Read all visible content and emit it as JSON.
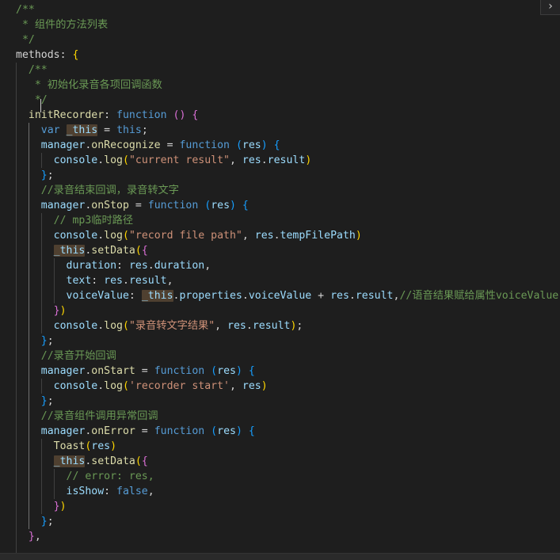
{
  "colors": {
    "background": "#1e1e1e",
    "comment": "#6a9955",
    "keyword": "#569cd6",
    "control": "#c586c0",
    "function": "#dcdcaa",
    "property": "#9cdcfe",
    "string": "#ce9178",
    "plain": "#d4d4d4",
    "bracket_gold": "#ffd700",
    "bracket_pink": "#da70d6",
    "bracket_blue": "#179fff"
  },
  "sidebar_toggle": {
    "icon": "chevron-right-icon",
    "glyph": "›"
  },
  "code_lines": [
    {
      "indent": 0,
      "tokens": [
        [
          "/**",
          "#6a9955"
        ]
      ]
    },
    {
      "indent": 0,
      "tokens": [
        [
          " * 组件的方法列表",
          "#6a9955"
        ]
      ]
    },
    {
      "indent": 0,
      "tokens": [
        [
          " */",
          "#6a9955"
        ]
      ]
    },
    {
      "indent": 0,
      "tokens": [
        [
          "methods",
          "#d4d4d4"
        ],
        [
          ": ",
          "#d4d4d4"
        ],
        [
          "{",
          "#ffd700"
        ]
      ]
    },
    {
      "indent": 1,
      "tokens": [
        [
          "/**",
          "#6a9955"
        ]
      ]
    },
    {
      "indent": 1,
      "tokens": [
        [
          " * 初始化录音各项回调函数",
          "#6a9955"
        ]
      ]
    },
    {
      "indent": 1,
      "tokens": [
        [
          " */",
          "#6a9955"
        ]
      ]
    },
    {
      "indent": 1,
      "tokens": [
        [
          "initRecorder",
          "#dcdcaa"
        ],
        [
          ": ",
          "#d4d4d4"
        ],
        [
          "function",
          "#569cd6"
        ],
        [
          " ",
          "#d4d4d4"
        ],
        [
          "()",
          "#da70d6"
        ],
        [
          " ",
          "#d4d4d4"
        ],
        [
          "{",
          "#da70d6"
        ]
      ]
    },
    {
      "indent": 2,
      "tokens": [
        [
          "var",
          "#569cd6"
        ],
        [
          " ",
          "#d4d4d4"
        ],
        [
          "_this",
          "#9cdcfe",
          "hl"
        ],
        [
          " = ",
          "#d4d4d4"
        ],
        [
          "this",
          "#569cd6"
        ],
        [
          ";",
          "#d4d4d4"
        ]
      ]
    },
    {
      "indent": 2,
      "tokens": [
        [
          "manager",
          "#9cdcfe"
        ],
        [
          ".",
          "#d4d4d4"
        ],
        [
          "onRecognize",
          "#dcdcaa"
        ],
        [
          " = ",
          "#d4d4d4"
        ],
        [
          "function",
          "#569cd6"
        ],
        [
          " ",
          "#d4d4d4"
        ],
        [
          "(",
          "#179fff"
        ],
        [
          "res",
          "#9cdcfe"
        ],
        [
          ")",
          "#179fff"
        ],
        [
          " ",
          "#d4d4d4"
        ],
        [
          "{",
          "#179fff"
        ]
      ]
    },
    {
      "indent": 3,
      "tokens": [
        [
          "console",
          "#9cdcfe"
        ],
        [
          ".",
          "#d4d4d4"
        ],
        [
          "log",
          "#dcdcaa"
        ],
        [
          "(",
          "#ffd700"
        ],
        [
          "\"current result\"",
          "#ce9178"
        ],
        [
          ", ",
          "#d4d4d4"
        ],
        [
          "res",
          "#9cdcfe"
        ],
        [
          ".",
          "#d4d4d4"
        ],
        [
          "result",
          "#9cdcfe"
        ],
        [
          ")",
          "#ffd700"
        ]
      ]
    },
    {
      "indent": 2,
      "tokens": [
        [
          "}",
          "#179fff"
        ],
        [
          ";",
          "#d4d4d4"
        ]
      ]
    },
    {
      "indent": 2,
      "tokens": [
        [
          "//录音结束回调，录音转文字",
          "#6a9955"
        ]
      ]
    },
    {
      "indent": 2,
      "tokens": [
        [
          "manager",
          "#9cdcfe"
        ],
        [
          ".",
          "#d4d4d4"
        ],
        [
          "onStop",
          "#dcdcaa"
        ],
        [
          " = ",
          "#d4d4d4"
        ],
        [
          "function",
          "#569cd6"
        ],
        [
          " ",
          "#d4d4d4"
        ],
        [
          "(",
          "#179fff"
        ],
        [
          "res",
          "#9cdcfe"
        ],
        [
          ")",
          "#179fff"
        ],
        [
          " ",
          "#d4d4d4"
        ],
        [
          "{",
          "#179fff"
        ]
      ]
    },
    {
      "indent": 3,
      "tokens": [
        [
          "// mp3临时路径",
          "#6a9955"
        ]
      ]
    },
    {
      "indent": 3,
      "tokens": [
        [
          "console",
          "#9cdcfe"
        ],
        [
          ".",
          "#d4d4d4"
        ],
        [
          "log",
          "#dcdcaa"
        ],
        [
          "(",
          "#ffd700"
        ],
        [
          "\"record file path\"",
          "#ce9178"
        ],
        [
          ", ",
          "#d4d4d4"
        ],
        [
          "res",
          "#9cdcfe"
        ],
        [
          ".",
          "#d4d4d4"
        ],
        [
          "tempFilePath",
          "#9cdcfe"
        ],
        [
          ")",
          "#ffd700"
        ]
      ]
    },
    {
      "indent": 3,
      "tokens": [
        [
          "_this",
          "#9cdcfe",
          "hl"
        ],
        [
          ".",
          "#d4d4d4"
        ],
        [
          "setData",
          "#dcdcaa"
        ],
        [
          "(",
          "#ffd700"
        ],
        [
          "{",
          "#da70d6"
        ]
      ]
    },
    {
      "indent": 4,
      "tokens": [
        [
          "duration",
          "#9cdcfe"
        ],
        [
          ": ",
          "#d4d4d4"
        ],
        [
          "res",
          "#9cdcfe"
        ],
        [
          ".",
          "#d4d4d4"
        ],
        [
          "duration",
          "#9cdcfe"
        ],
        [
          ",",
          "#d4d4d4"
        ]
      ]
    },
    {
      "indent": 4,
      "tokens": [
        [
          "text",
          "#9cdcfe"
        ],
        [
          ": ",
          "#d4d4d4"
        ],
        [
          "res",
          "#9cdcfe"
        ],
        [
          ".",
          "#d4d4d4"
        ],
        [
          "result",
          "#9cdcfe"
        ],
        [
          ",",
          "#d4d4d4"
        ]
      ]
    },
    {
      "indent": 4,
      "tokens": [
        [
          "voiceValue",
          "#9cdcfe"
        ],
        [
          ": ",
          "#d4d4d4"
        ],
        [
          "_this",
          "#9cdcfe",
          "hl"
        ],
        [
          ".",
          "#d4d4d4"
        ],
        [
          "properties",
          "#9cdcfe"
        ],
        [
          ".",
          "#d4d4d4"
        ],
        [
          "voiceValue",
          "#9cdcfe"
        ],
        [
          " + ",
          "#d4d4d4"
        ],
        [
          "res",
          "#9cdcfe"
        ],
        [
          ".",
          "#d4d4d4"
        ],
        [
          "result",
          "#9cdcfe"
        ],
        [
          ",",
          "#d4d4d4"
        ],
        [
          "//语音结果赋给属性voiceValue",
          "#6a9955"
        ]
      ]
    },
    {
      "indent": 3,
      "tokens": [
        [
          "}",
          "#da70d6"
        ],
        [
          ")",
          "#ffd700"
        ]
      ]
    },
    {
      "indent": 3,
      "tokens": [
        [
          "console",
          "#9cdcfe"
        ],
        [
          ".",
          "#d4d4d4"
        ],
        [
          "log",
          "#dcdcaa"
        ],
        [
          "(",
          "#ffd700"
        ],
        [
          "\"录音转文字结果\"",
          "#ce9178"
        ],
        [
          ", ",
          "#d4d4d4"
        ],
        [
          "res",
          "#9cdcfe"
        ],
        [
          ".",
          "#d4d4d4"
        ],
        [
          "result",
          "#9cdcfe"
        ],
        [
          ")",
          "#ffd700"
        ],
        [
          ";",
          "#d4d4d4"
        ]
      ]
    },
    {
      "indent": 2,
      "tokens": [
        [
          "}",
          "#179fff"
        ],
        [
          ";",
          "#d4d4d4"
        ]
      ]
    },
    {
      "indent": 2,
      "tokens": [
        [
          "//录音开始回调",
          "#6a9955"
        ]
      ]
    },
    {
      "indent": 2,
      "tokens": [
        [
          "manager",
          "#9cdcfe"
        ],
        [
          ".",
          "#d4d4d4"
        ],
        [
          "onStart",
          "#dcdcaa"
        ],
        [
          " = ",
          "#d4d4d4"
        ],
        [
          "function",
          "#569cd6"
        ],
        [
          " ",
          "#d4d4d4"
        ],
        [
          "(",
          "#179fff"
        ],
        [
          "res",
          "#9cdcfe"
        ],
        [
          ")",
          "#179fff"
        ],
        [
          " ",
          "#d4d4d4"
        ],
        [
          "{",
          "#179fff"
        ]
      ]
    },
    {
      "indent": 3,
      "tokens": [
        [
          "console",
          "#9cdcfe"
        ],
        [
          ".",
          "#d4d4d4"
        ],
        [
          "log",
          "#dcdcaa"
        ],
        [
          "(",
          "#ffd700"
        ],
        [
          "'recorder start'",
          "#ce9178"
        ],
        [
          ", ",
          "#d4d4d4"
        ],
        [
          "res",
          "#9cdcfe"
        ],
        [
          ")",
          "#ffd700"
        ]
      ]
    },
    {
      "indent": 2,
      "tokens": [
        [
          "}",
          "#179fff"
        ],
        [
          ";",
          "#d4d4d4"
        ]
      ]
    },
    {
      "indent": 2,
      "tokens": [
        [
          "//录音组件调用异常回调",
          "#6a9955"
        ]
      ]
    },
    {
      "indent": 2,
      "tokens": [
        [
          "manager",
          "#9cdcfe"
        ],
        [
          ".",
          "#d4d4d4"
        ],
        [
          "onError",
          "#dcdcaa"
        ],
        [
          " = ",
          "#d4d4d4"
        ],
        [
          "function",
          "#569cd6"
        ],
        [
          " ",
          "#d4d4d4"
        ],
        [
          "(",
          "#179fff"
        ],
        [
          "res",
          "#9cdcfe"
        ],
        [
          ")",
          "#179fff"
        ],
        [
          " ",
          "#d4d4d4"
        ],
        [
          "{",
          "#179fff"
        ]
      ]
    },
    {
      "indent": 3,
      "tokens": [
        [
          "Toast",
          "#dcdcaa"
        ],
        [
          "(",
          "#ffd700"
        ],
        [
          "res",
          "#9cdcfe"
        ],
        [
          ")",
          "#ffd700"
        ]
      ]
    },
    {
      "indent": 3,
      "tokens": [
        [
          "_this",
          "#9cdcfe",
          "hl"
        ],
        [
          ".",
          "#d4d4d4"
        ],
        [
          "setData",
          "#dcdcaa"
        ],
        [
          "(",
          "#ffd700"
        ],
        [
          "{",
          "#da70d6"
        ]
      ]
    },
    {
      "indent": 4,
      "tokens": [
        [
          "// error: res,",
          "#6a9955"
        ]
      ]
    },
    {
      "indent": 4,
      "tokens": [
        [
          "isShow",
          "#9cdcfe"
        ],
        [
          ": ",
          "#d4d4d4"
        ],
        [
          "false",
          "#569cd6"
        ],
        [
          ",",
          "#d4d4d4"
        ]
      ]
    },
    {
      "indent": 3,
      "tokens": [
        [
          "}",
          "#da70d6"
        ],
        [
          ")",
          "#ffd700"
        ]
      ]
    },
    {
      "indent": 2,
      "tokens": [
        [
          "}",
          "#179fff"
        ],
        [
          ";",
          "#d4d4d4"
        ]
      ]
    },
    {
      "indent": 1,
      "tokens": [
        [
          "}",
          "#da70d6"
        ],
        [
          ",",
          "#d4d4d4"
        ]
      ]
    },
    {
      "indent": 1,
      "tokens": []
    }
  ]
}
